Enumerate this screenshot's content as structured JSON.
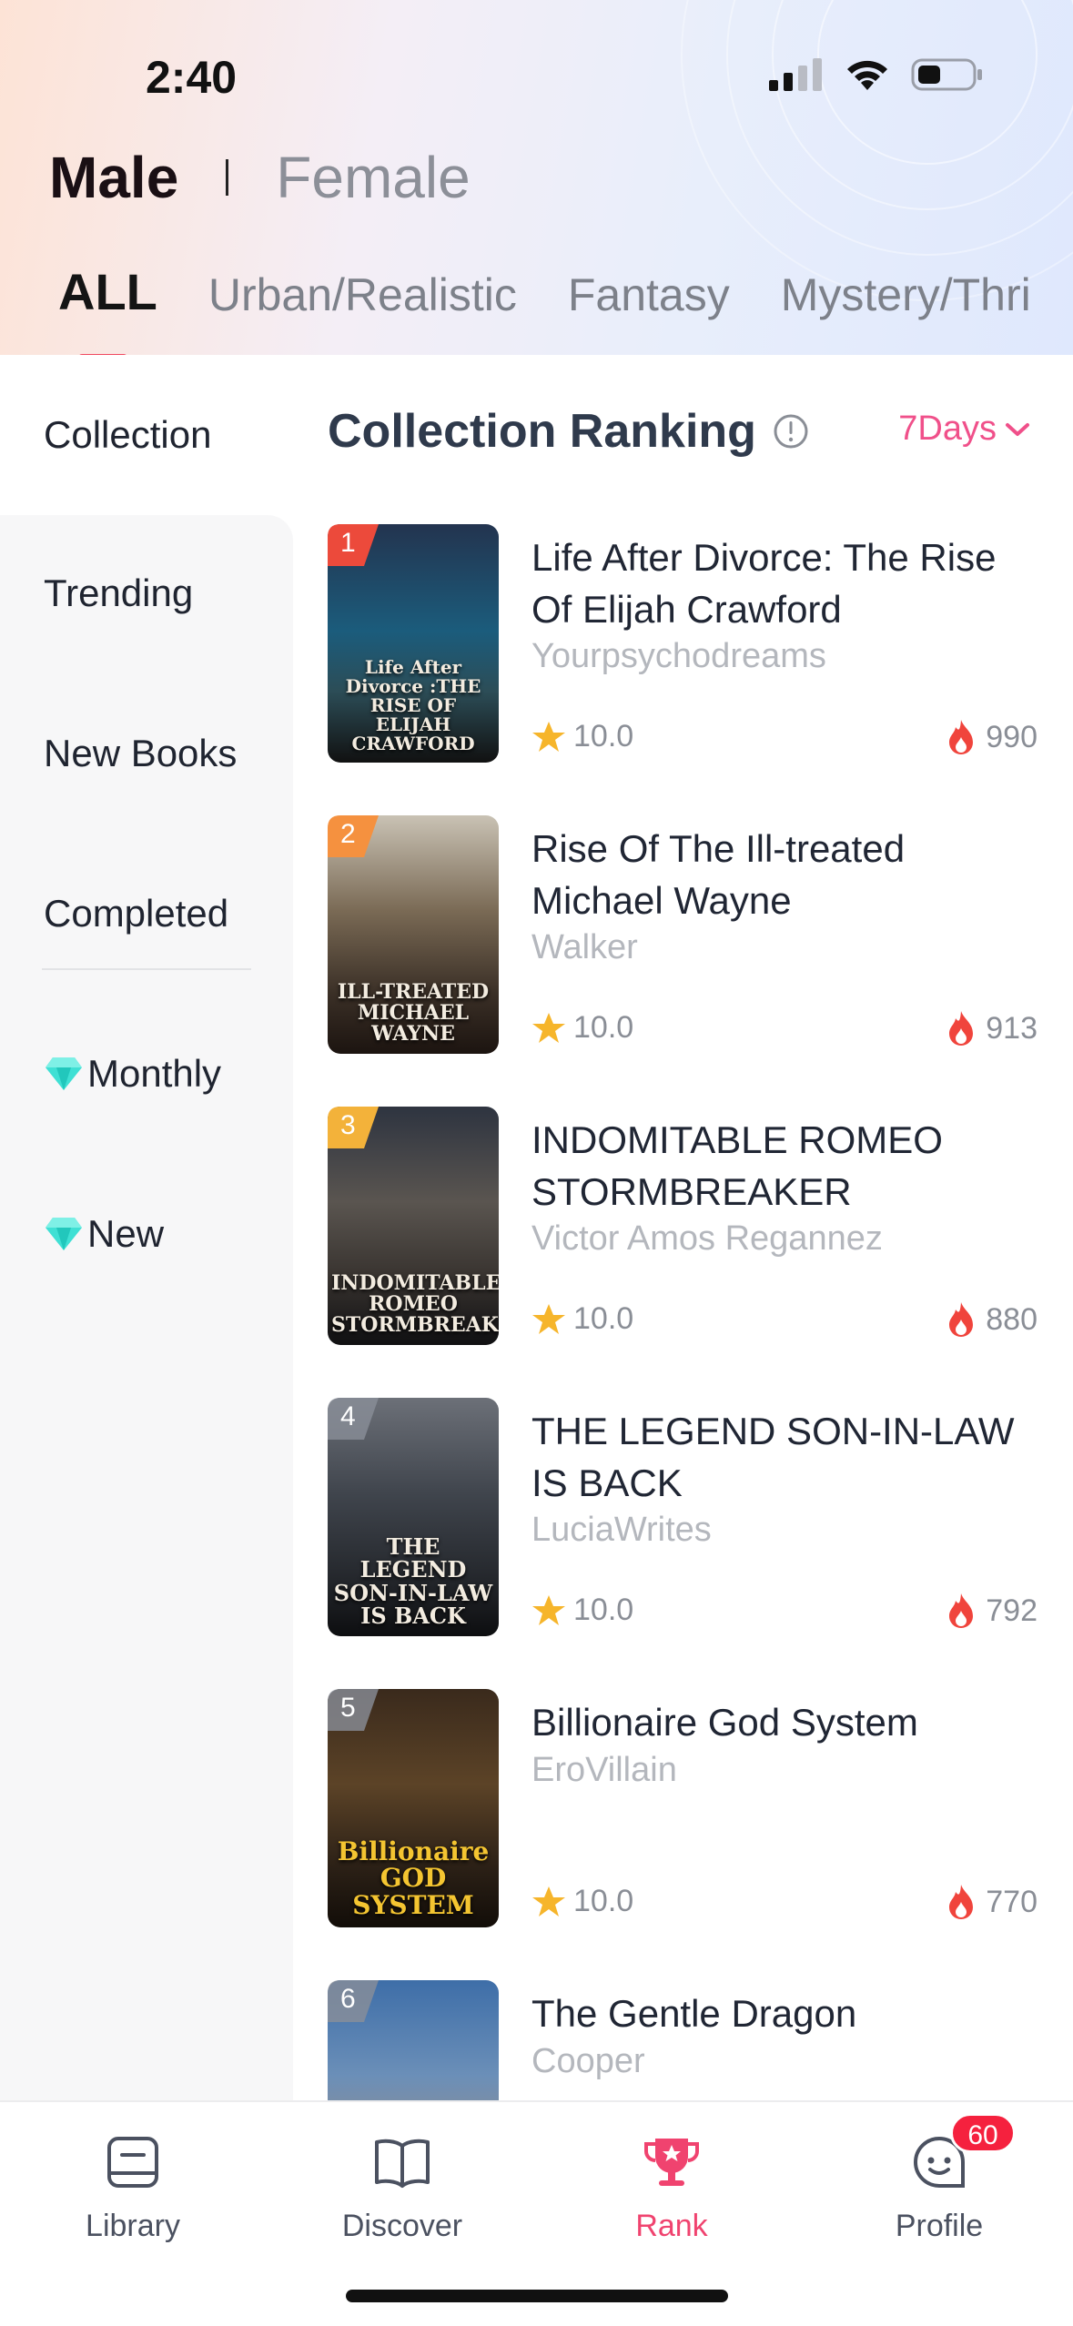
{
  "status": {
    "time": "2:40"
  },
  "gender_tabs": [
    {
      "label": "Male",
      "active": true
    },
    {
      "label": "Female",
      "active": false
    }
  ],
  "categories": [
    {
      "label": "ALL",
      "active": true
    },
    {
      "label": "Urban/Realistic"
    },
    {
      "label": "Fantasy"
    },
    {
      "label": "Mystery/Thri"
    }
  ],
  "sidebar": {
    "items": [
      {
        "label": "Collection",
        "active": true
      },
      {
        "label": "Trending"
      },
      {
        "label": "New Books"
      },
      {
        "label": "Completed"
      },
      {
        "label": "Monthly",
        "icon": "diamond-icon"
      },
      {
        "label": "New",
        "icon": "diamond-icon"
      }
    ]
  },
  "ranking": {
    "title": "Collection Ranking",
    "info_icon": "info-icon",
    "period": "7Days"
  },
  "books": [
    {
      "rank": "1",
      "title": "Life After Divorce: The Rise Of Elijah Crawford",
      "author": "Yourpsychodreams",
      "rating": "10.0",
      "heat": "990",
      "cover_text": "Life After Divorce :THE RISE OF ELIJAH CRAWFORD"
    },
    {
      "rank": "2",
      "title": "Rise Of The Ill-treated Michael Wayne",
      "author": "Walker",
      "rating": "10.0",
      "heat": "913",
      "cover_text": "ILL-TREATED MICHAEL WAYNE"
    },
    {
      "rank": "3",
      "title": "INDOMITABLE ROMEO STORMBREAKER",
      "author": "Victor Amos Regannez",
      "rating": "10.0",
      "heat": "880",
      "cover_text": "INDOMITABLE ROMEO STORMBREAKER"
    },
    {
      "rank": "4",
      "title": "THE LEGEND SON-IN-LAW IS BACK",
      "author": "LuciaWrites",
      "rating": "10.0",
      "heat": "792",
      "cover_text": "THE LEGEND SON-IN-LAW IS BACK"
    },
    {
      "rank": "5",
      "title": "Billionaire God System",
      "author": "EroVillain",
      "rating": "10.0",
      "heat": "770",
      "cover_text": "Billionaire GOD SYSTEM"
    },
    {
      "rank": "6",
      "title": "The Gentle Dragon",
      "author": "Cooper",
      "rating": "",
      "heat": "",
      "cover_text": ""
    }
  ],
  "tabbar": [
    {
      "label": "Library",
      "icon": "library-icon"
    },
    {
      "label": "Discover",
      "icon": "book-open-icon"
    },
    {
      "label": "Rank",
      "icon": "trophy-icon",
      "active": true
    },
    {
      "label": "Profile",
      "icon": "profile-face-icon"
    }
  ],
  "notifications": {
    "count": "60"
  },
  "colors": {
    "accent": "#f0436f",
    "pink": "#f0508a",
    "underline": "#f0485f",
    "badge_red": "#f5213e"
  }
}
